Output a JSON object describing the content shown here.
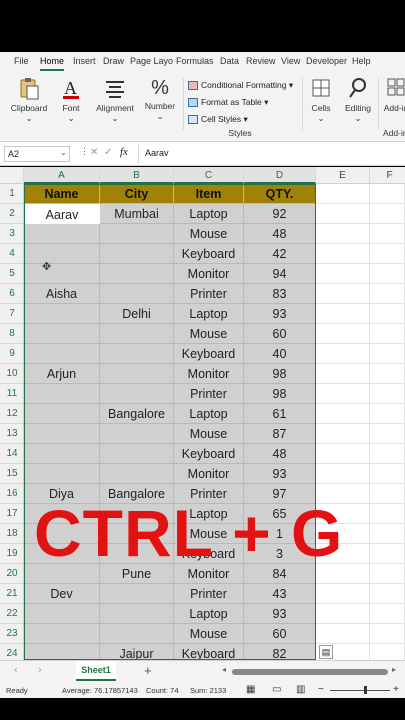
{
  "ribbon_tabs": [
    "File",
    "Home",
    "Insert",
    "Draw",
    "Page Layo",
    "Formulas",
    "Data",
    "Review",
    "View",
    "Developer",
    "Help"
  ],
  "active_tab": "Home",
  "ribbon": {
    "clipboard": "Clipboard",
    "font": "Font",
    "alignment": "Alignment",
    "number": "Number",
    "conditional_formatting": "Conditional Formatting ▾",
    "format_as_table": "Format as Table ▾",
    "cell_styles": "Cell Styles ▾",
    "styles_group": "Styles",
    "cells": "Cells",
    "editing": "Editing",
    "addins": "Add-in",
    "addins_group": "Add-in"
  },
  "formula_bar": {
    "name_box": "A2",
    "fx": "fx",
    "value": "Aarav"
  },
  "columns": [
    "A",
    "B",
    "C",
    "D",
    "E",
    "F"
  ],
  "rows": [
    "1",
    "2",
    "3",
    "4",
    "5",
    "6",
    "7",
    "8",
    "9",
    "10",
    "11",
    "12",
    "13",
    "14",
    "15",
    "16",
    "17",
    "18",
    "19",
    "20",
    "21",
    "22",
    "23",
    "24"
  ],
  "table": {
    "headers": [
      "Name",
      "City",
      "Item",
      "QTY."
    ],
    "cells": [
      [
        "Aarav",
        "Mumbai",
        "Laptop",
        "92"
      ],
      [
        "",
        "",
        "Mouse",
        "48"
      ],
      [
        "",
        "",
        "Keyboard",
        "42"
      ],
      [
        "",
        "",
        "Monitor",
        "94"
      ],
      [
        "Aisha",
        "",
        "Printer",
        "83"
      ],
      [
        "",
        "Delhi",
        "Laptop",
        "93"
      ],
      [
        "",
        "",
        "Mouse",
        "60"
      ],
      [
        "",
        "",
        "Keyboard",
        "40"
      ],
      [
        "Arjun",
        "",
        "Monitor",
        "98"
      ],
      [
        "",
        "",
        "Printer",
        "98"
      ],
      [
        "",
        "Bangalore",
        "Laptop",
        "61"
      ],
      [
        "",
        "",
        "Mouse",
        "87"
      ],
      [
        "",
        "",
        "Keyboard",
        "48"
      ],
      [
        "",
        "",
        "Monitor",
        "93"
      ],
      [
        "Diya",
        "Bangalore",
        "Printer",
        "97"
      ],
      [
        "",
        "",
        "Laptop",
        "65"
      ],
      [
        "",
        "",
        "Mouse",
        "1"
      ],
      [
        "",
        "",
        "Keyboard",
        "3"
      ],
      [
        "",
        "Pune",
        "Monitor",
        "84"
      ],
      [
        "Dev",
        "",
        "Printer",
        "43"
      ],
      [
        "",
        "",
        "Laptop",
        "93"
      ],
      [
        "",
        "",
        "Mouse",
        "60"
      ],
      [
        "",
        "Jaipur",
        "Keyboard",
        "82"
      ]
    ]
  },
  "overlay_text": "CTRL + G",
  "sheet_tab": "Sheet1",
  "add_sheet": "+",
  "status": {
    "ready": "Ready",
    "average": "Average: 76.17857143",
    "count": "Count: 74",
    "sum": "Sum: 2133"
  },
  "colors": {
    "header_fill": "#a08208",
    "selection": "#217346",
    "overlay": "#e31212"
  }
}
